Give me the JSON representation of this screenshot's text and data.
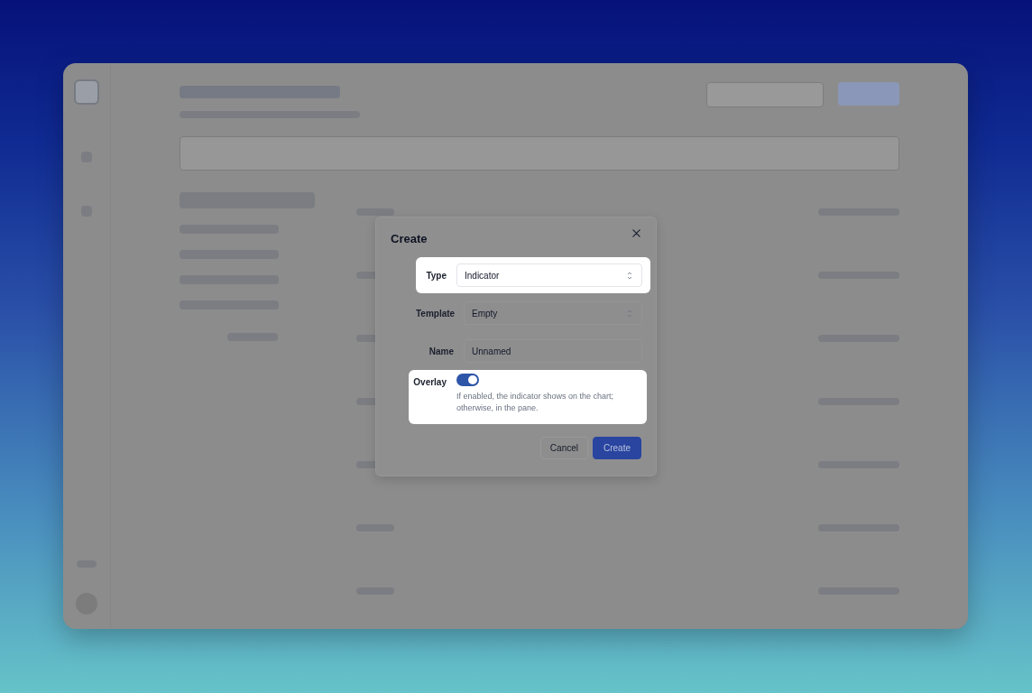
{
  "dialog": {
    "title": "Create",
    "fields": [
      {
        "kind": "select",
        "label": "Type",
        "value": "Indicator",
        "highlighted": true
      },
      {
        "kind": "select",
        "label": "Template",
        "value": "Empty",
        "highlighted": false
      },
      {
        "kind": "text",
        "label": "Name",
        "value": "Unnamed",
        "highlighted": false
      },
      {
        "kind": "toggle",
        "label": "Overlay",
        "on": true,
        "help": "If enabled, the indicator shows on the chart; otherwise, in the pane.",
        "highlighted": true
      }
    ],
    "buttons": [
      {
        "kind": "secondary",
        "label": "Cancel"
      },
      {
        "kind": "primary",
        "label": "Create"
      }
    ]
  }
}
